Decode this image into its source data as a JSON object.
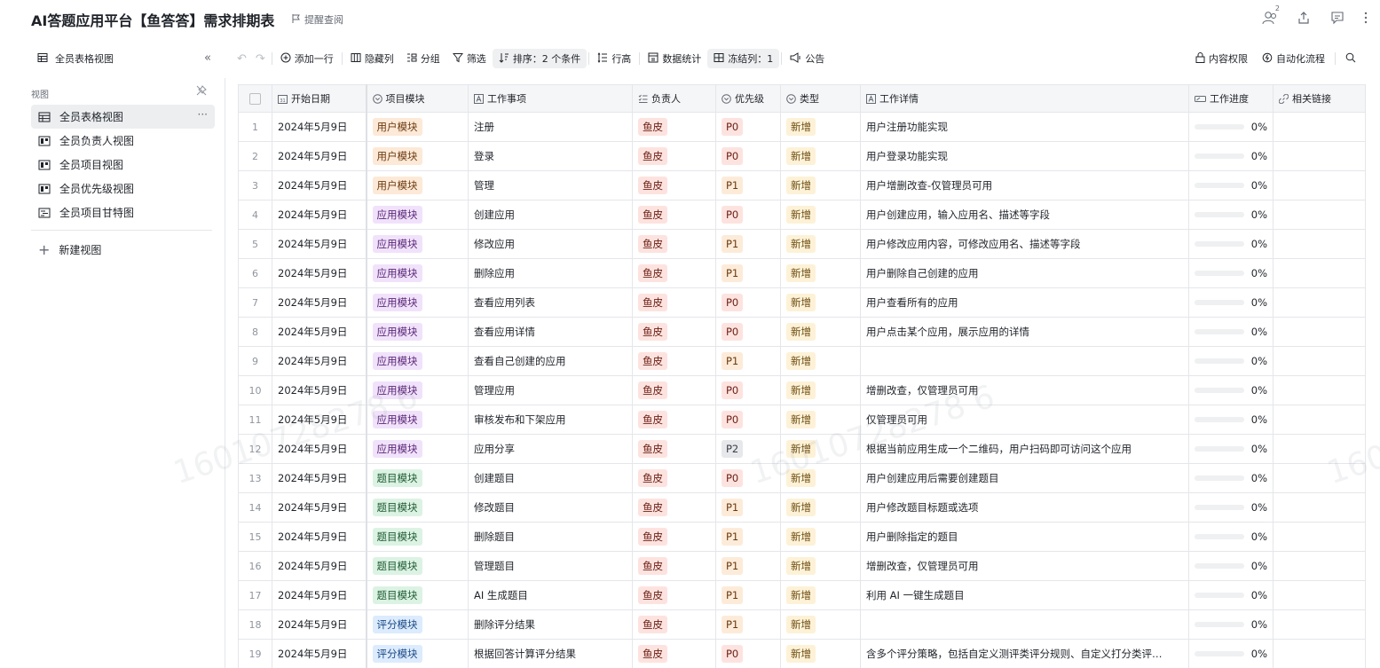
{
  "header": {
    "title": "AI答题应用平台【鱼答答】需求排期表",
    "remind_label": "提醒查阅",
    "collab_count": "2"
  },
  "toolbar": {
    "view_name": "全员表格视图",
    "add_row": "添加一行",
    "hide_cols": "隐藏列",
    "group": "分组",
    "filter": "筛选",
    "sort": "排序：2 个条件",
    "row_height": "行高",
    "stats": "数据统计",
    "freeze": "冻结列：1",
    "notice": "公告",
    "permission": "内容权限",
    "automation": "自动化流程"
  },
  "sidebar": {
    "heading": "视图",
    "items": [
      {
        "label": "全员表格视图",
        "icon": "table-icon",
        "active": true
      },
      {
        "label": "全员负责人视图",
        "icon": "kanban-icon",
        "active": false
      },
      {
        "label": "全员项目视图",
        "icon": "kanban-icon",
        "active": false
      },
      {
        "label": "全员优先级视图",
        "icon": "kanban-icon",
        "active": false
      },
      {
        "label": "全员项目甘特图",
        "icon": "gantt-icon",
        "active": false
      }
    ],
    "new_view": "新建视图"
  },
  "columns": [
    {
      "label": "开始日期",
      "icon": "calendar-icon"
    },
    {
      "label": "项目模块",
      "icon": "select-icon"
    },
    {
      "label": "工作事项",
      "icon": "text-icon"
    },
    {
      "label": "负责人",
      "icon": "multi-select-icon"
    },
    {
      "label": "优先级",
      "icon": "select-icon"
    },
    {
      "label": "类型",
      "icon": "select-icon"
    },
    {
      "label": "工作详情",
      "icon": "text-icon"
    },
    {
      "label": "工作进度",
      "icon": "progress-icon"
    },
    {
      "label": "相关链接",
      "icon": "link-icon"
    }
  ],
  "colors": {
    "module": {
      "用户模块": [
        "#fde9d7",
        "#6b3a10"
      ],
      "应用模块": [
        "#f1e2fb",
        "#5a2778"
      ],
      "题目模块": [
        "#dcf3e4",
        "#1f5b33"
      ],
      "评分模块": [
        "#dcebfd",
        "#1b4a86"
      ]
    },
    "owner": [
      "#fde3df",
      "#6b1f14"
    ],
    "priority": {
      "P0": [
        "#fde3df",
        "#6b1f14"
      ],
      "P1": [
        "#fdebd9",
        "#6b3a10"
      ],
      "P2": [
        "#e6e8eb",
        "#3c4047"
      ]
    },
    "type": [
      "#fdf2d7",
      "#6b4a10"
    ]
  },
  "rows": [
    {
      "n": "1",
      "date": "2024年5月9日",
      "module": "用户模块",
      "task": "注册",
      "owner": "鱼皮",
      "priority": "P0",
      "type": "新增",
      "detail": "用户注册功能实现",
      "progress": 0,
      "progress_label": "0%",
      "link": ""
    },
    {
      "n": "2",
      "date": "2024年5月9日",
      "module": "用户模块",
      "task": "登录",
      "owner": "鱼皮",
      "priority": "P0",
      "type": "新增",
      "detail": "用户登录功能实现",
      "progress": 0,
      "progress_label": "0%",
      "link": ""
    },
    {
      "n": "3",
      "date": "2024年5月9日",
      "module": "用户模块",
      "task": "管理",
      "owner": "鱼皮",
      "priority": "P1",
      "type": "新增",
      "detail": "用户增删改查-仅管理员可用",
      "progress": 0,
      "progress_label": "0%",
      "link": ""
    },
    {
      "n": "4",
      "date": "2024年5月9日",
      "module": "应用模块",
      "task": "创建应用",
      "owner": "鱼皮",
      "priority": "P0",
      "type": "新增",
      "detail": "用户创建应用，输入应用名、描述等字段",
      "progress": 0,
      "progress_label": "0%",
      "link": ""
    },
    {
      "n": "5",
      "date": "2024年5月9日",
      "module": "应用模块",
      "task": "修改应用",
      "owner": "鱼皮",
      "priority": "P1",
      "type": "新增",
      "detail": "用户修改应用内容，可修改应用名、描述等字段",
      "progress": 0,
      "progress_label": "0%",
      "link": ""
    },
    {
      "n": "6",
      "date": "2024年5月9日",
      "module": "应用模块",
      "task": "删除应用",
      "owner": "鱼皮",
      "priority": "P1",
      "type": "新增",
      "detail": "用户删除自己创建的应用",
      "progress": 0,
      "progress_label": "0%",
      "link": ""
    },
    {
      "n": "7",
      "date": "2024年5月9日",
      "module": "应用模块",
      "task": "查看应用列表",
      "owner": "鱼皮",
      "priority": "P0",
      "type": "新增",
      "detail": "用户查看所有的应用",
      "progress": 0,
      "progress_label": "0%",
      "link": ""
    },
    {
      "n": "8",
      "date": "2024年5月9日",
      "module": "应用模块",
      "task": "查看应用详情",
      "owner": "鱼皮",
      "priority": "P0",
      "type": "新增",
      "detail": "用户点击某个应用，展示应用的详情",
      "progress": 0,
      "progress_label": "0%",
      "link": ""
    },
    {
      "n": "9",
      "date": "2024年5月9日",
      "module": "应用模块",
      "task": "查看自己创建的应用",
      "owner": "鱼皮",
      "priority": "P1",
      "type": "新增",
      "detail": "",
      "progress": 0,
      "progress_label": "0%",
      "link": ""
    },
    {
      "n": "10",
      "date": "2024年5月9日",
      "module": "应用模块",
      "task": "管理应用",
      "owner": "鱼皮",
      "priority": "P0",
      "type": "新增",
      "detail": "增删改查，仅管理员可用",
      "progress": 0,
      "progress_label": "0%",
      "link": ""
    },
    {
      "n": "11",
      "date": "2024年5月9日",
      "module": "应用模块",
      "task": "审核发布和下架应用",
      "owner": "鱼皮",
      "priority": "P0",
      "type": "新增",
      "detail": "仅管理员可用",
      "progress": 0,
      "progress_label": "0%",
      "link": ""
    },
    {
      "n": "12",
      "date": "2024年5月9日",
      "module": "应用模块",
      "task": "应用分享",
      "owner": "鱼皮",
      "priority": "P2",
      "type": "新增",
      "detail": "根据当前应用生成一个二维码，用户扫码即可访问这个应用",
      "progress": 0,
      "progress_label": "0%",
      "link": ""
    },
    {
      "n": "13",
      "date": "2024年5月9日",
      "module": "题目模块",
      "task": "创建题目",
      "owner": "鱼皮",
      "priority": "P0",
      "type": "新增",
      "detail": "用户创建应用后需要创建题目",
      "progress": 0,
      "progress_label": "0%",
      "link": ""
    },
    {
      "n": "14",
      "date": "2024年5月9日",
      "module": "题目模块",
      "task": "修改题目",
      "owner": "鱼皮",
      "priority": "P1",
      "type": "新增",
      "detail": "用户修改题目标题或选项",
      "progress": 0,
      "progress_label": "0%",
      "link": ""
    },
    {
      "n": "15",
      "date": "2024年5月9日",
      "module": "题目模块",
      "task": "删除题目",
      "owner": "鱼皮",
      "priority": "P1",
      "type": "新增",
      "detail": "用户删除指定的题目",
      "progress": 0,
      "progress_label": "0%",
      "link": ""
    },
    {
      "n": "16",
      "date": "2024年5月9日",
      "module": "题目模块",
      "task": "管理题目",
      "owner": "鱼皮",
      "priority": "P1",
      "type": "新增",
      "detail": "增删改查，仅管理员可用",
      "progress": 0,
      "progress_label": "0%",
      "link": ""
    },
    {
      "n": "17",
      "date": "2024年5月9日",
      "module": "题目模块",
      "task": "AI 生成题目",
      "owner": "鱼皮",
      "priority": "P1",
      "type": "新增",
      "detail": "利用 AI 一键生成题目",
      "progress": 0,
      "progress_label": "0%",
      "link": ""
    },
    {
      "n": "18",
      "date": "2024年5月9日",
      "module": "评分模块",
      "task": "删除评分结果",
      "owner": "鱼皮",
      "priority": "P1",
      "type": "新增",
      "detail": "",
      "progress": 0,
      "progress_label": "0%",
      "link": ""
    },
    {
      "n": "19",
      "date": "2024年5月9日",
      "module": "评分模块",
      "task": "根据回答计算评分结果",
      "owner": "鱼皮",
      "priority": "P0",
      "type": "新增",
      "detail": "含多个评分策略，包括自定义测评类评分规则、自定义打分类评…",
      "progress": 0,
      "progress_label": "0%",
      "link": ""
    }
  ],
  "watermark": "16010728278 6"
}
